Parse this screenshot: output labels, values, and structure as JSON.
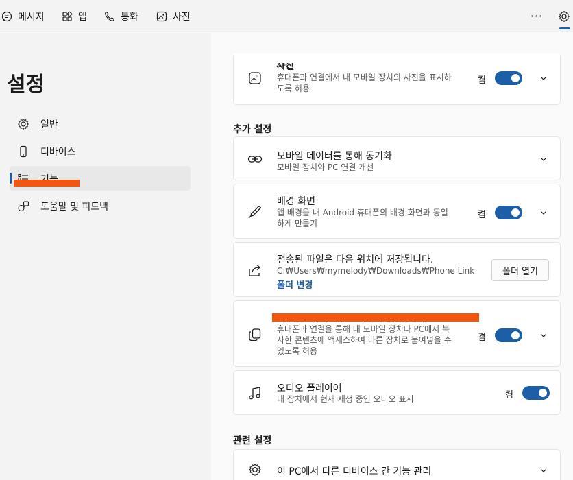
{
  "topbar": {
    "tabs": [
      {
        "label": "메시지",
        "icon": "message-icon"
      },
      {
        "label": "앱",
        "icon": "apps-icon"
      },
      {
        "label": "통화",
        "icon": "phone-icon"
      },
      {
        "label": "사진",
        "icon": "photo-icon"
      }
    ],
    "more_label": "···",
    "settings_icon": "gear-icon"
  },
  "sidebar": {
    "title": "설정",
    "items": [
      {
        "label": "일반",
        "icon": "gear-icon"
      },
      {
        "label": "디바이스",
        "icon": "phone-device-icon"
      },
      {
        "label": "기능",
        "icon": "features-list-icon",
        "active": true
      },
      {
        "label": "도움말 및 피드백",
        "icon": "help-feedback-icon"
      }
    ]
  },
  "main": {
    "photos": {
      "title": "사진",
      "desc": "휴대폰과 연결에서 내 모바일 장치의 사진을 표시하도록 허용",
      "state": "켬"
    },
    "additional_title": "추가 설정",
    "mobile_data": {
      "title": "모바일 데이터를 통해 동기화",
      "desc": "모바일 장치와 PC 연결 개선"
    },
    "wallpaper": {
      "title": "배경 화면",
      "desc": "앱 배경을 내 Android 휴대폰의 배경 화면과 동일하게 만들기",
      "state": "켬"
    },
    "transfer": {
      "title": "전송된 파일은 다음 위치에 저장됩니다.",
      "path": "C:₩Users₩mymelody₩Downloads₩Phone Link",
      "link": "폴더 변경",
      "button": "폴더 열기"
    },
    "copy_paste": {
      "title": "다른 장치로 콘텐츠 복사 및 붙여넣기",
      "desc": "휴대폰과 연결을 통해 내 모바일 장치나 PC에서 복사한 콘텐츠에 액세스하여 다른 장치로 붙여넣을 수 있도록 허용",
      "state": "켬"
    },
    "audio": {
      "title": "오디오 플레이어",
      "desc": "내 장치에서 현재 재생 중인 오디오 표시",
      "state": "켬"
    },
    "related_title": "관련 설정",
    "manage": {
      "title": "이 PC에서 다른 디바이스 간 기능 관리"
    }
  },
  "colors": {
    "accent": "#1c5fa7",
    "redaction": "#f4560e"
  }
}
